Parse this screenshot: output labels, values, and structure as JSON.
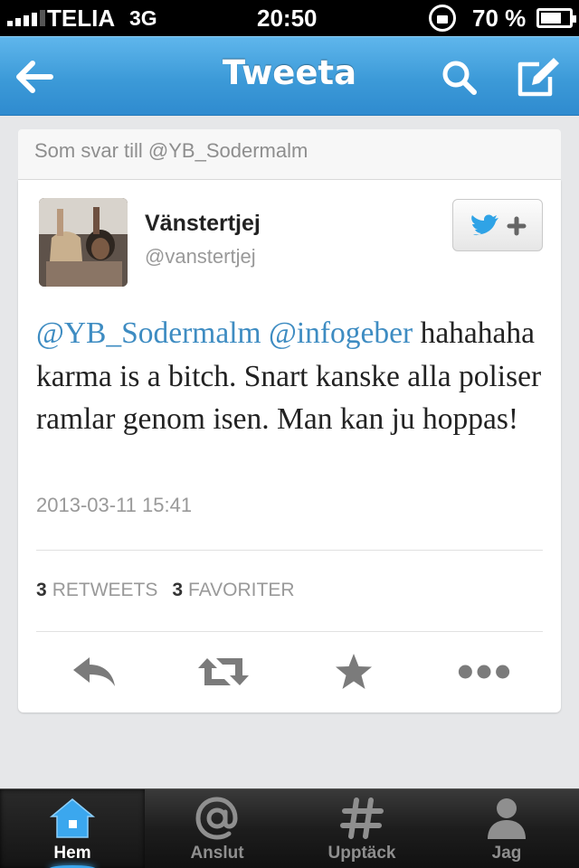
{
  "status_bar": {
    "carrier": "TELIA",
    "network": "3G",
    "time": "20:50",
    "battery": "70 %",
    "signal_bars": 4
  },
  "nav": {
    "title": "Tweeta",
    "back_icon": "back-arrow-icon",
    "search_icon": "search-icon",
    "compose_icon": "compose-icon"
  },
  "reply_header": "Som svar till @YB_Sodermalm",
  "tweet": {
    "display_name": "Vänstertjej",
    "screen_name": "@vanstertjej",
    "mention_1": "@YB_Sodermalm",
    "mention_2": "@infogeber",
    "body": "hahahaha karma is a bitch. Snart kanske alla poliser ramlar genom isen. Man kan ju hoppas!",
    "timestamp": "2013-03-11 15:41",
    "retweet_count": "3",
    "retweet_label": "RETWEETS",
    "favorite_count": "3",
    "favorite_label": "FAVORITER"
  },
  "actions": [
    "reply-icon",
    "retweet-icon",
    "favorite-star-icon",
    "more-icon"
  ],
  "tabs": [
    {
      "label": "Hem",
      "icon": "home-icon",
      "active": true
    },
    {
      "label": "Anslut",
      "icon": "at-icon",
      "active": false
    },
    {
      "label": "Upptäck",
      "icon": "hashtag-icon",
      "active": false
    },
    {
      "label": "Jag",
      "icon": "person-icon",
      "active": false
    }
  ],
  "colors": {
    "nav_blue": "#3c9ad8",
    "mention_blue": "#3e8cc2",
    "twitter_bird": "#2fa3e6",
    "active_tab_glow": "#3ba7ee"
  }
}
